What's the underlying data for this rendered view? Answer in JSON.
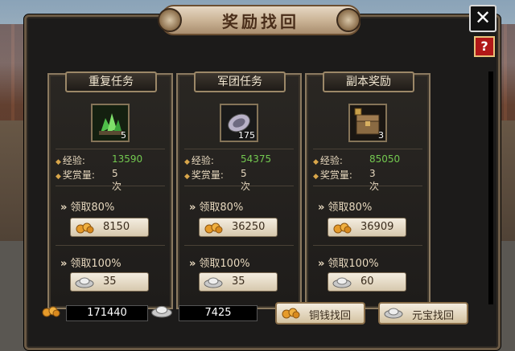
{
  "title": "奖励找回",
  "close_label": "✕",
  "help_label": "?",
  "cards": [
    {
      "tab": "重复任务",
      "icon": "jade-ore-icon",
      "icon_count": "5",
      "exp_label": "经验:",
      "exp_value": "13590",
      "reward_label": "奖赏量:",
      "reward_value": "5次",
      "claim80_label": "领取80%",
      "claim80_value": "8150",
      "claim100_label": "领取100%",
      "claim100_value": "35"
    },
    {
      "tab": "军团任务",
      "icon": "silver-token-icon",
      "icon_count": "175",
      "exp_label": "经验:",
      "exp_value": "54375",
      "reward_label": "奖赏量:",
      "reward_value": "5次",
      "claim80_label": "领取80%",
      "claim80_value": "36250",
      "claim100_label": "领取100%",
      "claim100_value": "35"
    },
    {
      "tab": "副本奖励",
      "icon": "treasure-chest-icon",
      "icon_count": "3",
      "exp_label": "经验:",
      "exp_value": "85050",
      "reward_label": "奖赏量:",
      "reward_value": "3次",
      "claim80_label": "领取80%",
      "claim80_value": "36909",
      "claim100_label": "领取100%",
      "claim100_value": "60"
    }
  ],
  "bottom": {
    "copper_total": "171440",
    "ingot_total": "7425",
    "copper_retrieve_label": "铜钱找回",
    "ingot_retrieve_label": "元宝找回"
  },
  "colors": {
    "exp_green": "#73c850",
    "panel_border": "#6b5a45",
    "gold_accent": "#d9a64a"
  }
}
